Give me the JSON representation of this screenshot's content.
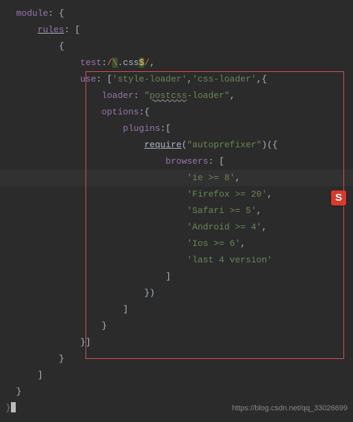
{
  "code": {
    "module_key": "module",
    "rules_key": "rules",
    "test_key": "test",
    "test_regex_open": "/",
    "test_regex_esc": "\\",
    "test_regex_body": ".css",
    "test_regex_dollar": "$",
    "test_regex_close": "/",
    "use_key": "use",
    "style_loader": "'style-loader'",
    "css_loader": "'css-loader'",
    "loader_key": "loader",
    "postcss_pre": "\"",
    "postcss_main": "postcss",
    "postcss_post": "-loader\"",
    "options_key": "options",
    "plugins_key": "plugins",
    "require_fn": "require",
    "autoprefixer": "\"autoprefixer\"",
    "browsers_key": "browsers",
    "b1": "'ie >= 8'",
    "b2": "'Firefox >= 20'",
    "b3": "'Safari >= 5'",
    "b4": "'Android >= 4'",
    "b5": "'Ios >= 6'",
    "b6": "'last 4 version'"
  },
  "chart_data": {
    "type": "table",
    "title": "Webpack module rules config (postcss autoprefixer browsers)",
    "series": [
      {
        "name": "browsers",
        "values": [
          "ie >= 8",
          "Firefox >= 20",
          "Safari >= 5",
          "Android >= 4",
          "Ios >= 6",
          "last 4 version"
        ]
      }
    ]
  },
  "watermark": "https://blog.csdn.net/qq_33026699",
  "s_badge": "S"
}
